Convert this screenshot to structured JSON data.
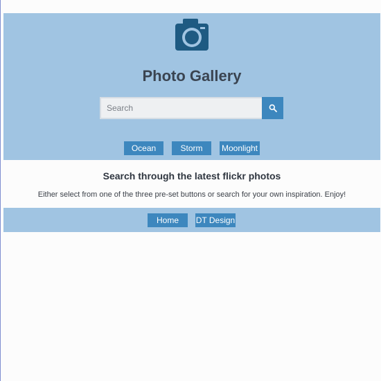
{
  "header": {
    "title": "Photo Gallery",
    "icon": "camera-icon",
    "background_color": "#a0c4e2"
  },
  "search": {
    "placeholder": "Search",
    "value": "",
    "button_icon": "search-icon"
  },
  "presets": [
    {
      "label": "Ocean"
    },
    {
      "label": "Storm"
    },
    {
      "label": "Moonlight"
    }
  ],
  "intro": {
    "heading": "Search through the latest flickr photos",
    "text": "Either select from one of the three pre-set buttons or search for your own inspiration. Enjoy!"
  },
  "footer": {
    "links": [
      {
        "label": "Home"
      },
      {
        "label": "DT Design"
      }
    ]
  },
  "colors": {
    "accent": "#3d87be",
    "icon": "#1e5a82"
  }
}
